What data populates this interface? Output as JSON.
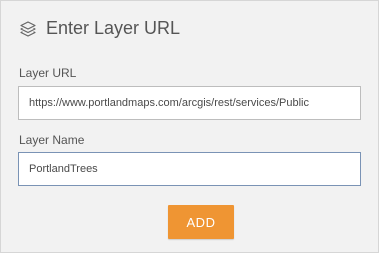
{
  "dialog": {
    "title": "Enter Layer URL",
    "icon": "layers-icon"
  },
  "layer_url": {
    "label": "Layer URL",
    "value": "https://www.portlandmaps.com/arcgis/rest/services/Public"
  },
  "layer_name": {
    "label": "Layer Name",
    "value": "PortlandTrees"
  },
  "actions": {
    "add_label": "ADD"
  },
  "colors": {
    "panel_bg": "#f2f2f2",
    "accent": "#ef9533"
  }
}
